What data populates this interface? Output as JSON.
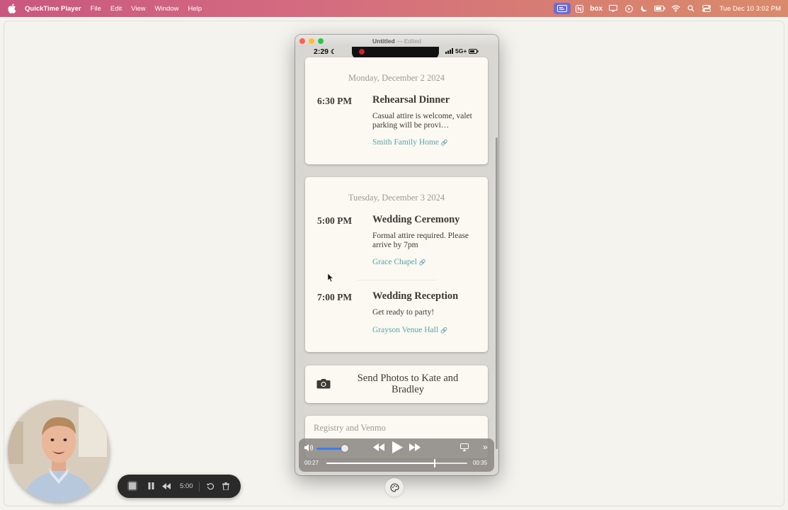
{
  "menubar": {
    "app_name": "QuickTime Player",
    "menus": [
      "File",
      "Edit",
      "View",
      "Window",
      "Help"
    ],
    "box_label": "box",
    "datetime": "Tue Dec 10  3:02 PM"
  },
  "qt_window": {
    "title": "Untitled",
    "title_separator": "—",
    "title_state": "Edited"
  },
  "phone": {
    "time": "2:29",
    "network": "5G+"
  },
  "schedule": {
    "day1": {
      "date": "Monday, December 2 2024",
      "events": [
        {
          "time": "6:30 PM",
          "title": "Rehearsal Dinner",
          "description": "Casual attire is welcome, valet parking will be provi…",
          "location": "Smith Family Home"
        }
      ]
    },
    "day2": {
      "date": "Tuesday, December 3 2024",
      "events": [
        {
          "time": "5:00 PM",
          "title": "Wedding Ceremony",
          "description": "Formal attire required. Please arrive by 7pm",
          "location": "Grace Chapel"
        },
        {
          "time": "7:00 PM",
          "title": "Wedding Reception",
          "description": "Get ready to party!",
          "location": "Grayson Venue Hall"
        }
      ]
    }
  },
  "photos": {
    "label": "Send Photos to Kate and Bradley",
    "icon": "camera-icon"
  },
  "registry": {
    "label": "Registry and Venmo"
  },
  "player": {
    "elapsed": "00:27",
    "duration": "00:35",
    "progress": 0.77,
    "volume": 0.95
  },
  "recording_toolbar": {
    "timer": "5:00"
  },
  "colors": {
    "link": "#5aa3a6",
    "card_bg": "#fbf9f1",
    "menubar_accent": "#6a6cd8",
    "volume_fill": "#3d7cf2",
    "record_dot": "#c1262b"
  }
}
